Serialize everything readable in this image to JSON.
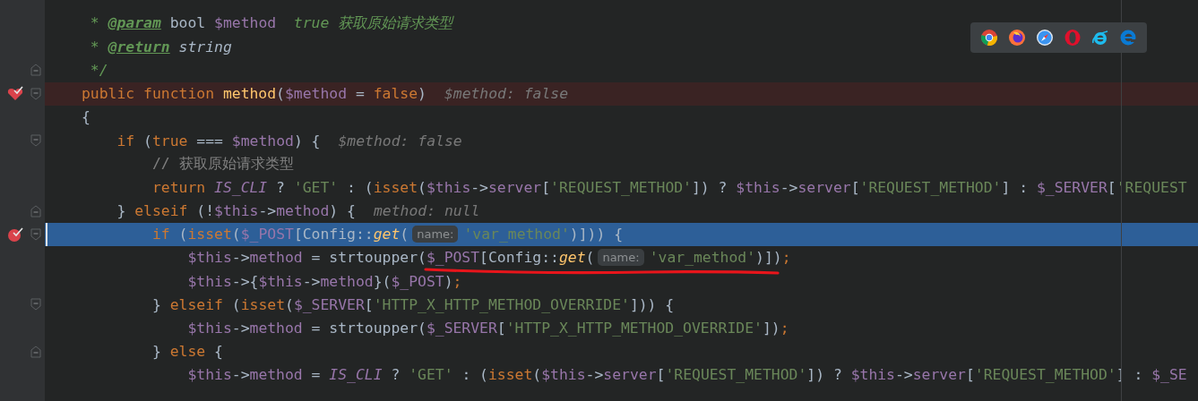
{
  "popup": {
    "icons": [
      {
        "kind": "chrome"
      },
      {
        "kind": "firefox"
      },
      {
        "kind": "safari"
      },
      {
        "kind": "opera"
      },
      {
        "kind": "ie"
      },
      {
        "kind": "edge"
      }
    ]
  },
  "lines": [
    {
      "segments": [
        {
          "kind": "code",
          "tokens": [
            {
              "kind": "doc",
              "text": " * "
            },
            {
              "kind": "tag",
              "text": "@param"
            },
            {
              "kind": "docp",
              "text": " bool "
            },
            {
              "kind": "var",
              "text": "$method"
            },
            {
              "kind": "doc",
              "text": "  true 获取原始请求类型"
            }
          ]
        }
      ]
    },
    {
      "segments": [
        {
          "kind": "code",
          "tokens": [
            {
              "kind": "doc",
              "text": " * "
            },
            {
              "kind": "tag",
              "text": "@return"
            },
            {
              "kind": "doci",
              "text": " string"
            }
          ]
        }
      ]
    },
    {
      "fold_end": true,
      "segments": [
        {
          "kind": "code",
          "tokens": [
            {
              "kind": "doc",
              "text": " */"
            }
          ]
        }
      ]
    },
    {
      "fold_start": true,
      "method_breakpoint": true,
      "segments": [
        {
          "kind": "code",
          "tokens": [
            {
              "kind": "kw",
              "text": "public function "
            },
            {
              "kind": "fn",
              "text": "method"
            },
            {
              "kind": "p",
              "text": "("
            },
            {
              "kind": "var",
              "text": "$method"
            },
            {
              "kind": "p",
              "text": " = "
            },
            {
              "kind": "kw",
              "text": "false"
            },
            {
              "kind": "p",
              "text": ")"
            }
          ]
        },
        {
          "kind": "value",
          "text": "$method: false"
        }
      ]
    },
    {
      "segments": [
        {
          "kind": "code",
          "tokens": [
            {
              "kind": "p",
              "text": "{"
            }
          ]
        }
      ]
    },
    {
      "fold_start": true,
      "segments": [
        {
          "kind": "code",
          "tokens": [
            {
              "kind": "kw",
              "text": "    if"
            },
            {
              "kind": "p",
              "text": " ("
            },
            {
              "kind": "kw",
              "text": "true"
            },
            {
              "kind": "p",
              "text": " === "
            },
            {
              "kind": "var",
              "text": "$method"
            },
            {
              "kind": "p",
              "text": ") {"
            }
          ]
        },
        {
          "kind": "value",
          "text": "$method: false"
        }
      ]
    },
    {
      "segments": [
        {
          "kind": "code",
          "tokens": [
            {
              "kind": "cm",
              "text": "        // 获取原始请求类型"
            }
          ]
        }
      ]
    },
    {
      "segments": [
        {
          "kind": "code",
          "tokens": [
            {
              "kind": "kw",
              "text": "        return "
            },
            {
              "kind": "const",
              "text": "IS_CLI"
            },
            {
              "kind": "p",
              "text": " ? "
            },
            {
              "kind": "str",
              "text": "'GET'"
            },
            {
              "kind": "p",
              "text": " : ("
            },
            {
              "kind": "kw",
              "text": "isset"
            },
            {
              "kind": "p",
              "text": "("
            },
            {
              "kind": "var",
              "text": "$this"
            },
            {
              "kind": "p",
              "text": "->"
            },
            {
              "kind": "var",
              "text": "server"
            },
            {
              "kind": "p",
              "text": "["
            },
            {
              "kind": "str",
              "text": "'REQUEST_METHOD'"
            },
            {
              "kind": "p",
              "text": "]) ? "
            },
            {
              "kind": "var",
              "text": "$this"
            },
            {
              "kind": "p",
              "text": "->"
            },
            {
              "kind": "var",
              "text": "server"
            },
            {
              "kind": "p",
              "text": "["
            },
            {
              "kind": "str",
              "text": "'REQUEST_METHOD'"
            },
            {
              "kind": "p",
              "text": "] : "
            },
            {
              "kind": "var",
              "text": "$_SERVER"
            },
            {
              "kind": "p",
              "text": "["
            },
            {
              "kind": "str",
              "text": "'REQUEST"
            }
          ]
        }
      ]
    },
    {
      "fold_end": true,
      "segments": [
        {
          "kind": "code",
          "tokens": [
            {
              "kind": "p",
              "text": "    } "
            },
            {
              "kind": "kw",
              "text": "elseif"
            },
            {
              "kind": "p",
              "text": " (!"
            },
            {
              "kind": "var",
              "text": "$this"
            },
            {
              "kind": "p",
              "text": "->"
            },
            {
              "kind": "var",
              "text": "method"
            },
            {
              "kind": "p",
              "text": ") {"
            }
          ]
        },
        {
          "kind": "value",
          "text": "method: null"
        }
      ]
    },
    {
      "fold_start": true,
      "breakpoint": true,
      "current": true,
      "segments": [
        {
          "kind": "code",
          "tokens": [
            {
              "kind": "kw",
              "text": "        if"
            },
            {
              "kind": "p",
              "text": " ("
            },
            {
              "kind": "kw",
              "text": "isset"
            },
            {
              "kind": "p",
              "text": "("
            },
            {
              "kind": "var",
              "text": "$_POST"
            },
            {
              "kind": "p",
              "text": "[Config::"
            },
            {
              "kind": "call",
              "text": "get"
            },
            {
              "kind": "p",
              "text": "("
            }
          ]
        },
        {
          "kind": "param",
          "text": "name:"
        },
        {
          "kind": "code",
          "tokens": [
            {
              "kind": "str",
              "text": "'var_method'"
            },
            {
              "kind": "p",
              "text": ")])) {"
            }
          ]
        }
      ]
    },
    {
      "segments": [
        {
          "kind": "code",
          "tokens": [
            {
              "kind": "var",
              "text": "            $this"
            },
            {
              "kind": "p",
              "text": "->"
            },
            {
              "kind": "var",
              "text": "method"
            },
            {
              "kind": "p",
              "text": " = strtoupper("
            }
          ]
        },
        {
          "kind": "underlined",
          "segments": [
            {
              "kind": "code",
              "tokens": [
                {
                  "kind": "var",
                  "text": "$_POST"
                },
                {
                  "kind": "p",
                  "text": "[Config::"
                },
                {
                  "kind": "call",
                  "text": "get"
                },
                {
                  "kind": "p",
                  "text": "("
                }
              ]
            },
            {
              "kind": "param",
              "text": "name:"
            },
            {
              "kind": "code",
              "tokens": [
                {
                  "kind": "str",
                  "text": "'var_method'"
                },
                {
                  "kind": "p",
                  "text": ")]"
                }
              ]
            }
          ]
        },
        {
          "kind": "code",
          "tokens": [
            {
              "kind": "p",
              "text": ")"
            },
            {
              "kind": "kw",
              "text": ";"
            }
          ]
        }
      ]
    },
    {
      "segments": [
        {
          "kind": "code",
          "tokens": [
            {
              "kind": "var",
              "text": "            $this"
            },
            {
              "kind": "p",
              "text": "->{"
            },
            {
              "kind": "var",
              "text": "$this"
            },
            {
              "kind": "p",
              "text": "->"
            },
            {
              "kind": "var",
              "text": "method"
            },
            {
              "kind": "p",
              "text": "}("
            },
            {
              "kind": "var",
              "text": "$_POST"
            },
            {
              "kind": "p",
              "text": ")"
            },
            {
              "kind": "kw",
              "text": ";"
            }
          ]
        }
      ]
    },
    {
      "fold_start": true,
      "segments": [
        {
          "kind": "code",
          "tokens": [
            {
              "kind": "p",
              "text": "        } "
            },
            {
              "kind": "kw",
              "text": "elseif"
            },
            {
              "kind": "p",
              "text": " ("
            },
            {
              "kind": "kw",
              "text": "isset"
            },
            {
              "kind": "p",
              "text": "("
            },
            {
              "kind": "var",
              "text": "$_SERVER"
            },
            {
              "kind": "p",
              "text": "["
            },
            {
              "kind": "str",
              "text": "'HTTP_X_HTTP_METHOD_OVERRIDE'"
            },
            {
              "kind": "p",
              "text": "])) {"
            }
          ]
        }
      ]
    },
    {
      "segments": [
        {
          "kind": "code",
          "tokens": [
            {
              "kind": "var",
              "text": "            $this"
            },
            {
              "kind": "p",
              "text": "->"
            },
            {
              "kind": "var",
              "text": "method"
            },
            {
              "kind": "p",
              "text": " = strtoupper("
            },
            {
              "kind": "var",
              "text": "$_SERVER"
            },
            {
              "kind": "p",
              "text": "["
            },
            {
              "kind": "str",
              "text": "'HTTP_X_HTTP_METHOD_OVERRIDE'"
            },
            {
              "kind": "p",
              "text": "])"
            },
            {
              "kind": "kw",
              "text": ";"
            }
          ]
        }
      ]
    },
    {
      "fold_end": true,
      "segments": [
        {
          "kind": "code",
          "tokens": [
            {
              "kind": "p",
              "text": "        } "
            },
            {
              "kind": "kw",
              "text": "else"
            },
            {
              "kind": "p",
              "text": " {"
            }
          ]
        }
      ]
    },
    {
      "segments": [
        {
          "kind": "code",
          "tokens": [
            {
              "kind": "var",
              "text": "            $this"
            },
            {
              "kind": "p",
              "text": "->"
            },
            {
              "kind": "var",
              "text": "method"
            },
            {
              "kind": "p",
              "text": " = "
            },
            {
              "kind": "const",
              "text": "IS_CLI"
            },
            {
              "kind": "p",
              "text": " ? "
            },
            {
              "kind": "str",
              "text": "'GET'"
            },
            {
              "kind": "p",
              "text": " : ("
            },
            {
              "kind": "kw",
              "text": "isset"
            },
            {
              "kind": "p",
              "text": "("
            },
            {
              "kind": "var",
              "text": "$this"
            },
            {
              "kind": "p",
              "text": "->"
            },
            {
              "kind": "var",
              "text": "server"
            },
            {
              "kind": "p",
              "text": "["
            },
            {
              "kind": "str",
              "text": "'REQUEST_METHOD'"
            },
            {
              "kind": "p",
              "text": "]) ? "
            },
            {
              "kind": "var",
              "text": "$this"
            },
            {
              "kind": "p",
              "text": "->"
            },
            {
              "kind": "var",
              "text": "server"
            },
            {
              "kind": "p",
              "text": "["
            },
            {
              "kind": "str",
              "text": "'REQUEST_METHOD'"
            },
            {
              "kind": "p",
              "text": "] : "
            },
            {
              "kind": "var",
              "text": "$_SE"
            }
          ]
        }
      ]
    }
  ]
}
